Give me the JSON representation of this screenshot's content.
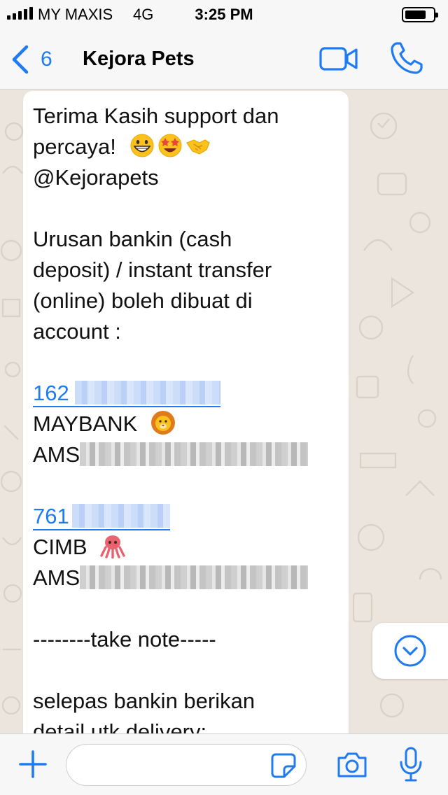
{
  "status_bar": {
    "carrier": "MY MAXIS",
    "network": "4G",
    "time": "3:25 PM",
    "battery_level": 0.75
  },
  "nav": {
    "back_count": "6",
    "title": "Kejora Pets",
    "icons": [
      "chevron-left-icon",
      "video-camera-icon",
      "phone-icon"
    ]
  },
  "message": {
    "line1": "Terima Kasih support dan",
    "line2": "percaya!",
    "line2_emojis": [
      "grinning-face-icon",
      "star-struck-icon",
      "handshake-icon"
    ],
    "line3": "@Kejorapets",
    "line4": "Urusan bankin (cash",
    "line5": "deposit) / instant transfer",
    "line6": "(online) boleh dibuat di",
    "line7": "account :",
    "acct1_prefix": "162",
    "bank1": "MAYBANK",
    "bank1_emoji": "lion-face-icon",
    "name1_prefix": "AMS",
    "acct2_prefix": "761",
    "bank2": "CIMB",
    "bank2_emoji": "octopus-icon",
    "name2_prefix": "AMS",
    "note": "--------take note-----",
    "line_after": "selepas bankin berikan",
    "line_last": "detail utk delivery:"
  },
  "input_bar": {
    "placeholder": "",
    "icons": [
      "plus-icon",
      "sticker-icon",
      "camera-icon",
      "microphone-icon"
    ]
  },
  "colors": {
    "accent": "#1e7bf2",
    "wallpaper": "#ece5dd",
    "bar": "#f7f7f7",
    "bubble": "#ffffff"
  }
}
